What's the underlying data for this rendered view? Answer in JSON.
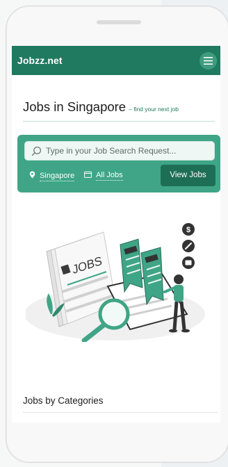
{
  "navbar": {
    "brand": "Jobzz.net",
    "menu_icon": "hamburger-icon"
  },
  "hero": {
    "title": "Jobs in Singapore",
    "subtitle": "– find your next job"
  },
  "search": {
    "placeholder": "Type in your Job Search Request...",
    "location_label": "Singapore",
    "category_label": "All Jobs",
    "button_label": "View Jobs",
    "icons": [
      "search-icon",
      "location-pin-icon",
      "calendar-icon"
    ]
  },
  "illustration": {
    "sign_text": "JOBS",
    "icons": [
      "dollar-icon",
      "pen-icon",
      "folder-icon",
      "magnifier-icon"
    ]
  },
  "categories": {
    "title": "Jobs by Categories"
  },
  "colors": {
    "brand": "#1f7a5f",
    "accent": "#3fa586",
    "button": "#1e6e55"
  }
}
